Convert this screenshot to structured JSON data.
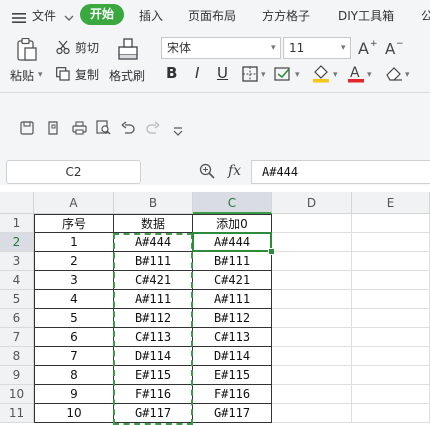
{
  "menu": {
    "file": "文件",
    "active": "开始",
    "tabs": [
      "插入",
      "页面布局",
      "方方格子",
      "DIY工具箱",
      "公"
    ]
  },
  "ribbon": {
    "paste": "粘贴",
    "cut": "剪切",
    "copy": "复制",
    "format_painter": "格式刷",
    "font_name": "宋体",
    "font_size": "11",
    "bold": "B",
    "italic": "I",
    "underline": "U"
  },
  "namebox": "C2",
  "fx": "fx",
  "formula": "A#444",
  "columns": [
    "A",
    "B",
    "C",
    "D",
    "E"
  ],
  "rows": [
    "1",
    "2",
    "3",
    "4",
    "5",
    "6",
    "7",
    "8",
    "9",
    "10",
    "11"
  ],
  "cells": [
    [
      "序号",
      "数据",
      "添加0"
    ],
    [
      "1",
      "A#444",
      "A#444"
    ],
    [
      "2",
      "B#111",
      "B#111"
    ],
    [
      "3",
      "C#421",
      "C#421"
    ],
    [
      "4",
      "A#111",
      "A#111"
    ],
    [
      "5",
      "B#112",
      "B#112"
    ],
    [
      "6",
      "C#113",
      "C#113"
    ],
    [
      "7",
      "D#114",
      "D#114"
    ],
    [
      "8",
      "E#115",
      "E#115"
    ],
    [
      "9",
      "F#116",
      "F#116"
    ],
    [
      "10",
      "G#117",
      "G#117"
    ]
  ],
  "colors": {
    "accent": "#38a83f",
    "selection": "#2e8b3a",
    "font_color": "#e0262b",
    "fill_color": "#f5c518"
  },
  "icons": [
    "menu-icon",
    "paste-icon",
    "cut-icon",
    "copy-icon",
    "format-painter-icon",
    "save-icon",
    "undo-icon",
    "redo-icon",
    "print-icon",
    "zoom-icon",
    "fill-color-icon",
    "font-color-icon",
    "eraser-icon",
    "border-icon"
  ]
}
